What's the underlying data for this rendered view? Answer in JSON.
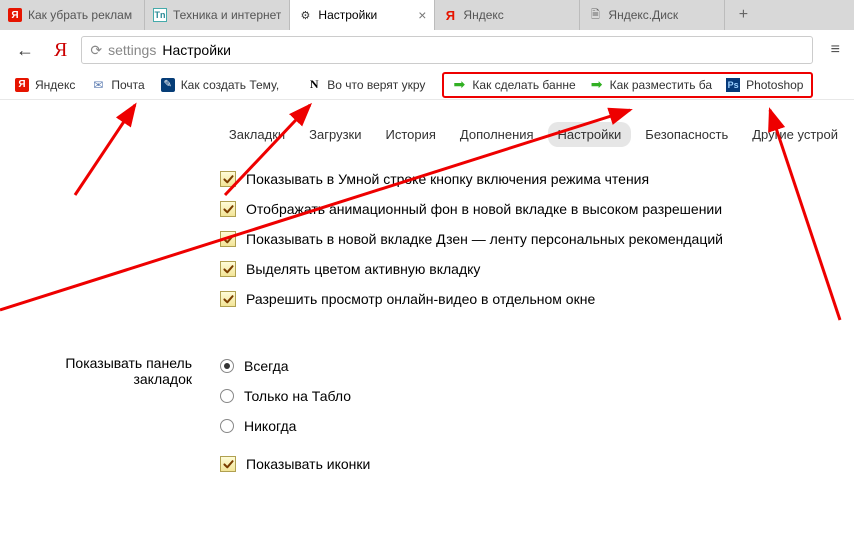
{
  "tabs": [
    {
      "title": "Как убрать реклам",
      "icon": "ya"
    },
    {
      "title": "Техника и интернет",
      "icon": "tn"
    },
    {
      "title": "Настройки",
      "icon": "gear",
      "active": true
    },
    {
      "title": "Яндекс",
      "icon": "ya-red"
    },
    {
      "title": "Яндекс.Диск",
      "icon": "file"
    }
  ],
  "address": {
    "prefix": "settings",
    "text": "Настройки"
  },
  "bookmarks_plain": [
    {
      "label": "Яндекс",
      "icon": "ya"
    },
    {
      "label": "Почта",
      "icon": "mail"
    },
    {
      "label": "Как создать Тему,",
      "icon": "lj"
    },
    {
      "label": "Во что верят укру",
      "icon": "n"
    }
  ],
  "bookmarks_highlighted": [
    {
      "label": "Как сделать банне",
      "icon": "arrow-g"
    },
    {
      "label": "Как разместить ба",
      "icon": "arrow-g"
    },
    {
      "label": "Photoshop",
      "icon": "ps"
    }
  ],
  "nav": {
    "items": [
      "Закладки",
      "Загрузки",
      "История",
      "Дополнения",
      "Настройки",
      "Безопасность",
      "Другие устрой"
    ],
    "active_index": 4
  },
  "checks_top": [
    "Показывать в Умной строке кнопку включения режима чтения",
    "Отображать анимационный фон в новой вкладке в высоком разрешении",
    "Показывать в новой вкладке Дзен — ленту персональных рекомендаций",
    "Выделять цветом активную вкладку",
    "Разрешить просмотр онлайн-видео в отдельном окне"
  ],
  "panel_section": {
    "label_l1": "Показывать панель",
    "label_l2": "закладок",
    "radios": [
      "Всегда",
      "Только на Табло",
      "Никогда"
    ],
    "radio_selected": 0,
    "check": "Показывать иконки"
  }
}
